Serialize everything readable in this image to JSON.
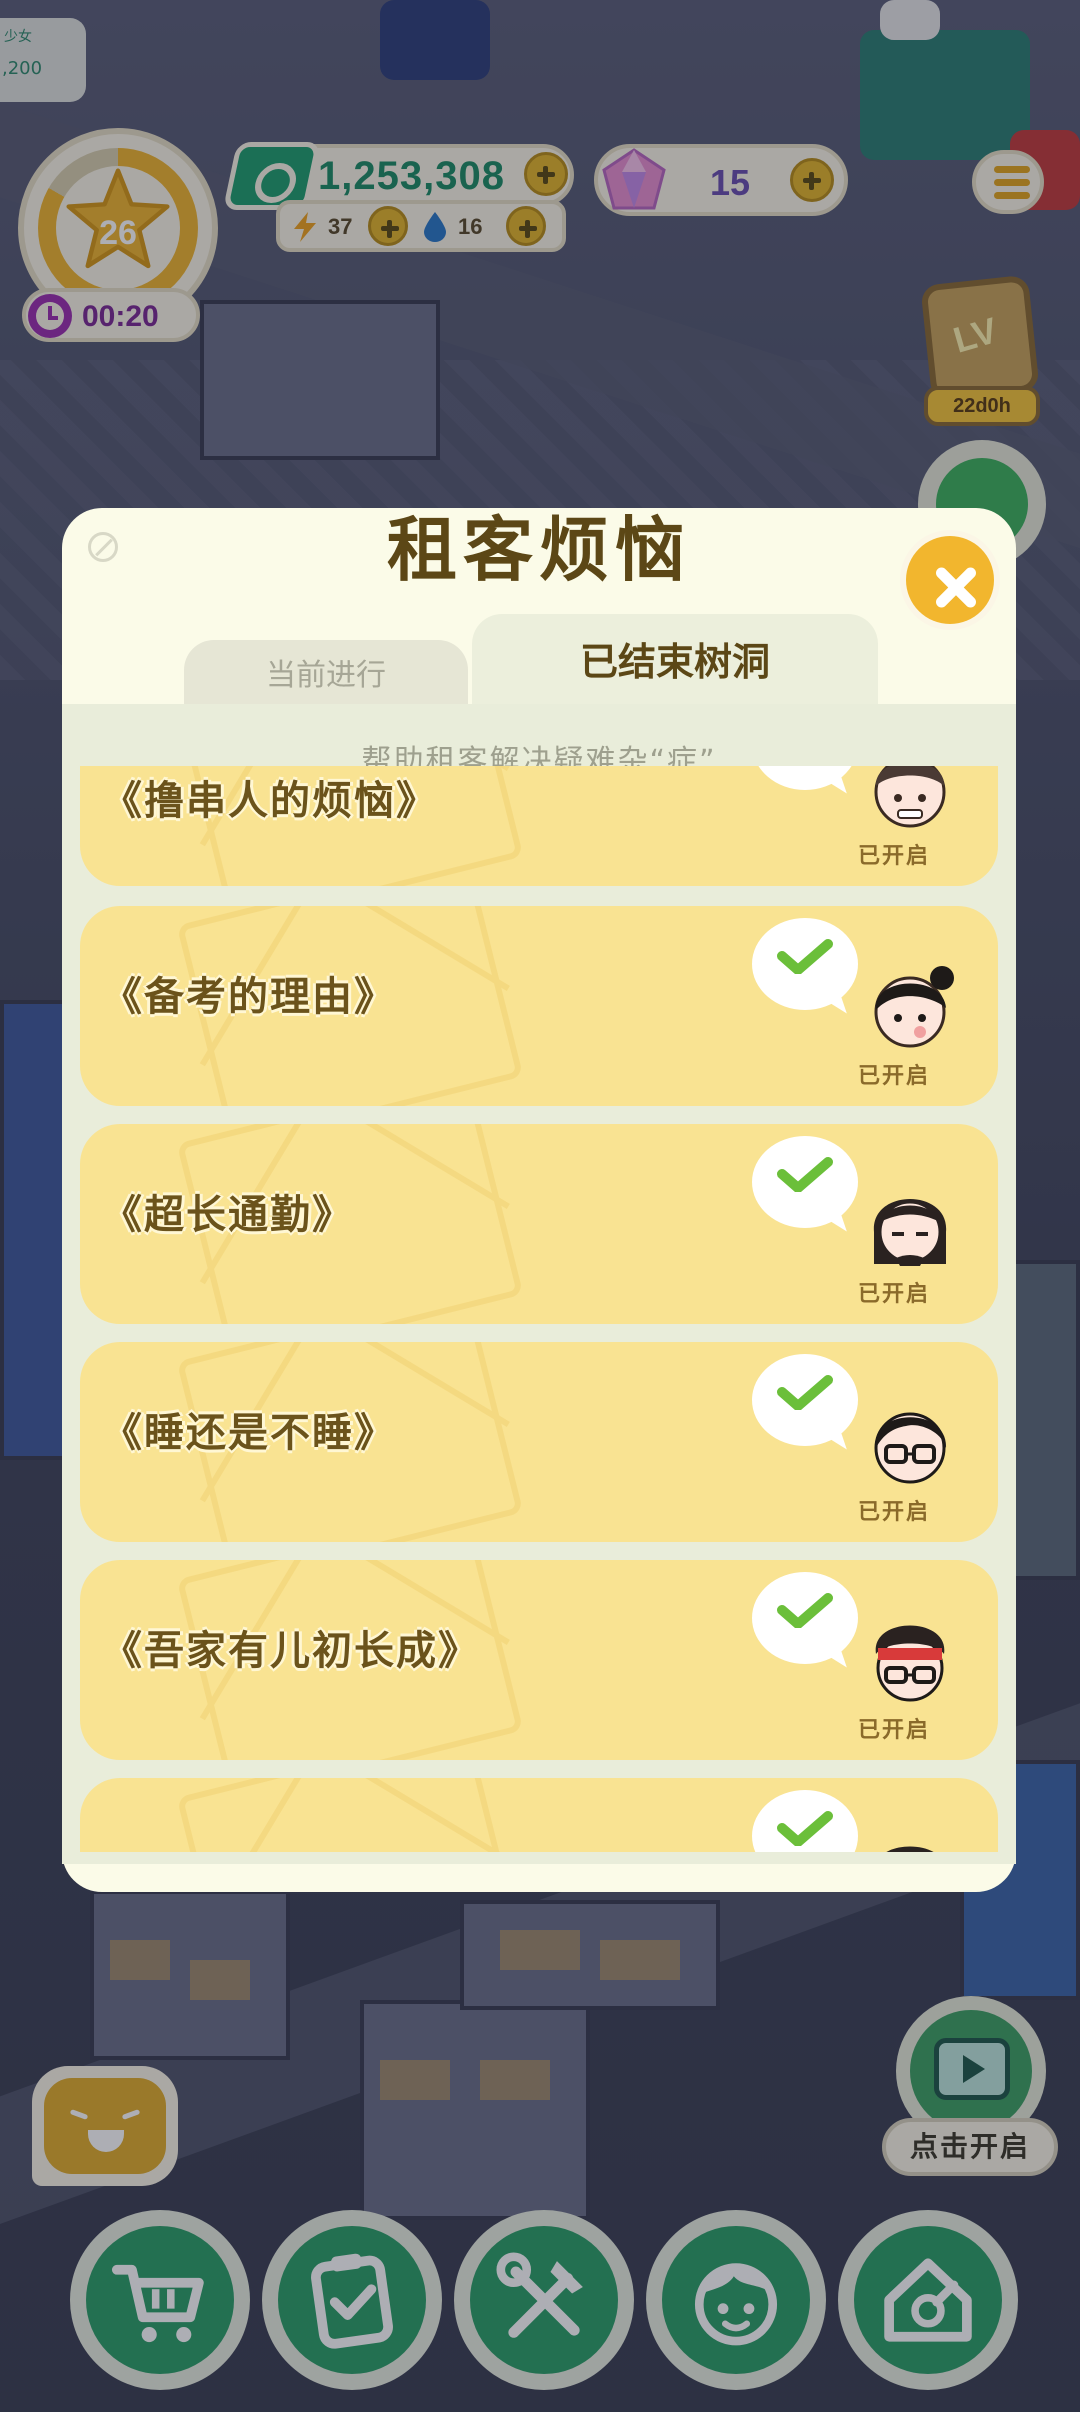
{
  "hud": {
    "corner_tag_line1": "少女",
    "corner_tag_line2": ",200",
    "level": "26",
    "timer": "00:20",
    "cash": "1,253,308",
    "energy": "37",
    "water": "16",
    "gems": "15",
    "event_timer": "22d0h",
    "icons": [
      "star-icon",
      "clock-icon",
      "cash-icon",
      "bolt-icon",
      "water-drop-icon",
      "gem-icon",
      "menu-icon"
    ]
  },
  "modal": {
    "title": "租客烦恼",
    "tabs": [
      {
        "label": "当前进行",
        "active": false
      },
      {
        "label": "已结束树洞",
        "active": true
      }
    ],
    "subtitle": "帮助租客解决疑难杂“症”",
    "items": [
      {
        "name": "《撸串人的烦恼》",
        "status": "已开启"
      },
      {
        "name": "《备考的理由》",
        "status": "已开启"
      },
      {
        "name": "《超长通勤》",
        "status": "已开启"
      },
      {
        "name": "《睡还是不睡》",
        "status": "已开启"
      },
      {
        "name": "《吾家有儿初长成》",
        "status": "已开启"
      },
      {
        "name": "",
        "status": ""
      }
    ]
  },
  "bottom": {
    "tv_label": "点击开启",
    "dock": [
      "shop-cart-icon",
      "tasks-clipboard-icon",
      "tools-icon",
      "tenant-face-icon",
      "home-settings-icon"
    ]
  },
  "colors": {
    "accent_yellow": "#f2b62e",
    "card_yellow": "#f9e392",
    "title_brown": "#5c4716",
    "dock_green": "#2ca068",
    "check_green": "#6bbf3a"
  }
}
